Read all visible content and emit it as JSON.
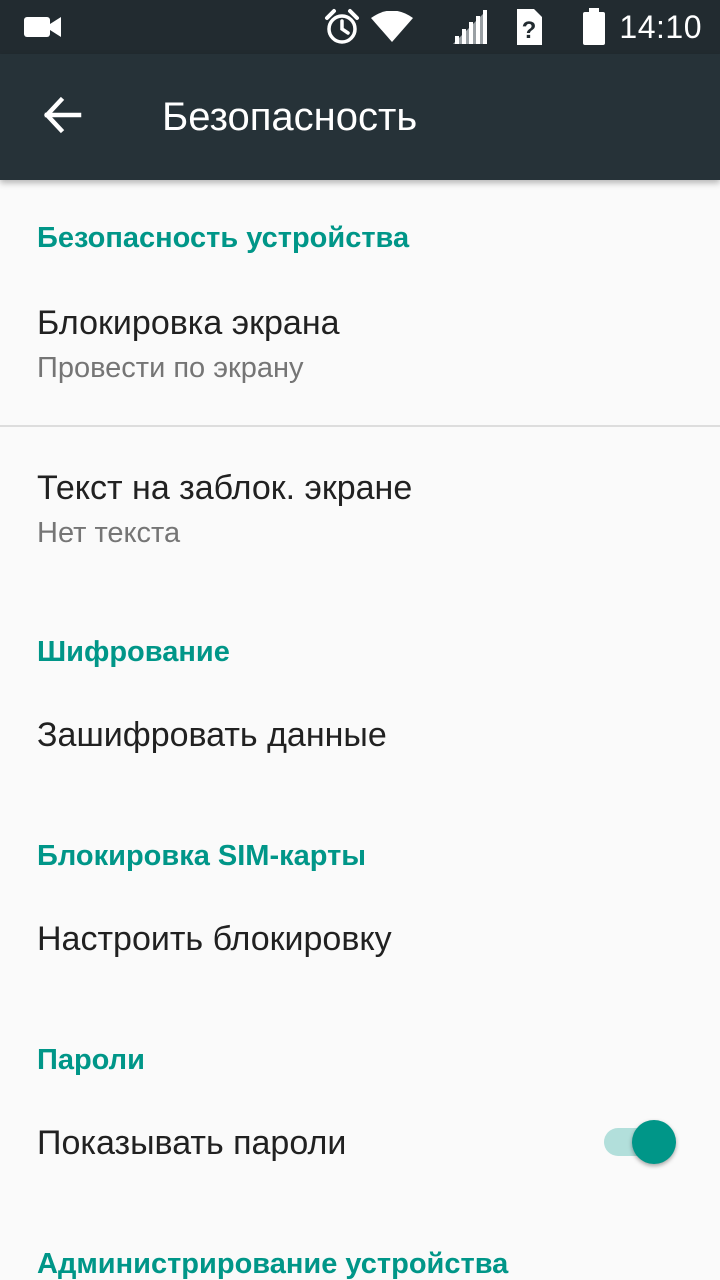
{
  "status_bar": {
    "time": "14:10",
    "icons": [
      "video-camera-icon",
      "alarm-clock-icon",
      "wifi-icon",
      "cell-signal-icon",
      "no-sim-icon",
      "battery-icon"
    ]
  },
  "app_bar": {
    "title": "Безопасность",
    "back_icon": "arrow-back-icon"
  },
  "colors": {
    "status_bar_bg": "#222b30",
    "app_bar_bg": "#263238",
    "accent": "#009688",
    "background": "#fafafa",
    "primary_text": "#212121",
    "secondary_text": "#757575"
  },
  "sections": {
    "device_security": {
      "header": "Безопасность устройства",
      "screen_lock": {
        "title": "Блокировка экрана",
        "summary": "Провести по экрану"
      },
      "lock_screen_text": {
        "title": "Текст на заблок. экране",
        "summary": "Нет текста"
      }
    },
    "encryption": {
      "header": "Шифрование",
      "encrypt_data": {
        "title": "Зашифровать данные"
      }
    },
    "sim_lock": {
      "header": "Блокировка SIM-карты",
      "setup_lock": {
        "title": "Настроить блокировку"
      }
    },
    "passwords": {
      "header": "Пароли",
      "show_passwords": {
        "title": "Показывать пароли",
        "enabled": true
      }
    },
    "device_admin": {
      "header": "Администрирование устройства"
    }
  }
}
